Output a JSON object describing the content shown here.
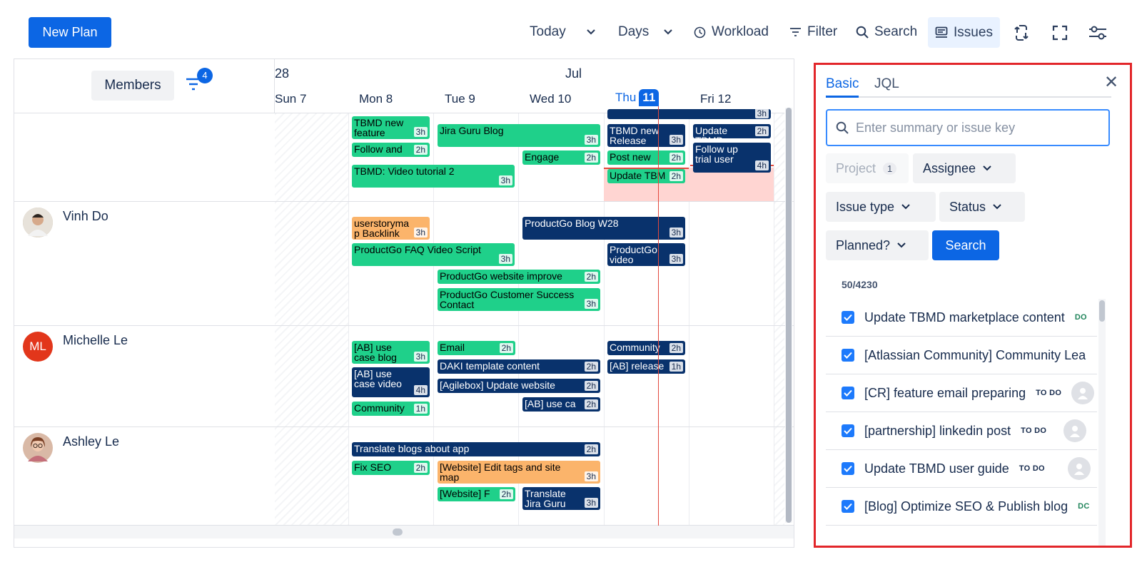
{
  "toolbar": {
    "new_plan_label": "New Plan",
    "today_label": "Today",
    "days_label": "Days",
    "workload_label": "Workload",
    "filter_label": "Filter",
    "search_label": "Search",
    "issues_label": "Issues"
  },
  "members_panel": {
    "members_label": "Members",
    "filter_count": "4"
  },
  "calendar": {
    "months": [
      "28",
      "Jul"
    ],
    "days": [
      "Sun 7",
      "Mon 8",
      "Tue 9",
      "Wed 10",
      "Thu",
      "Fri 12"
    ],
    "today_number": "11"
  },
  "members": [
    {
      "name": "",
      "initials": ""
    },
    {
      "name": "Vinh Do",
      "initials": ""
    },
    {
      "name": "Michelle Le",
      "initials": "ML",
      "color": "#e2361b"
    },
    {
      "name": "Ashley Le",
      "initials": ""
    }
  ],
  "tasks": [
    {
      "title": "TBMD new feature",
      "hours": "3h",
      "color": "green"
    },
    {
      "title": "Jira Guru Blog",
      "hours": "3h",
      "color": "green"
    },
    {
      "title": "TBMD new Release",
      "hours": "3h",
      "color": "navy"
    },
    {
      "title": "Update TBMD",
      "hours": "2h",
      "color": "navy"
    },
    {
      "title": "Follow and",
      "hours": "2h",
      "color": "green"
    },
    {
      "title": "Engage",
      "hours": "2h",
      "color": "green"
    },
    {
      "title": "Post new",
      "hours": "2h",
      "color": "green"
    },
    {
      "title": "Follow up trial user",
      "hours": "4h",
      "color": "navy"
    },
    {
      "title": "TBMD: Video tutorial 2",
      "hours": "3h",
      "color": "green"
    },
    {
      "title": "Update TBM",
      "hours": "2h",
      "color": "green"
    },
    {
      "title": "",
      "hours": "3h",
      "color": "navy"
    },
    {
      "title": "userstorymap Backlink",
      "hours": "3h",
      "color": "orange"
    },
    {
      "title": "ProductGo Blog W28",
      "hours": "3h",
      "color": "navy"
    },
    {
      "title": "ProductGo FAQ Video Script",
      "hours": "3h",
      "color": "green"
    },
    {
      "title": "ProductGo video making",
      "hours": "3h",
      "color": "navy"
    },
    {
      "title": "ProductGo website improve",
      "hours": "2h",
      "color": "green"
    },
    {
      "title": "ProductGo Customer Success Contact",
      "hours": "3h",
      "color": "green"
    },
    {
      "title": "[AB] use case blog",
      "hours": "3h",
      "color": "green"
    },
    {
      "title": "Email",
      "hours": "2h",
      "color": "green"
    },
    {
      "title": "Community",
      "hours": "2h",
      "color": "navy"
    },
    {
      "title": "DAKI template content",
      "hours": "2h",
      "color": "navy"
    },
    {
      "title": "[AB] release",
      "hours": "1h",
      "color": "navy"
    },
    {
      "title": "[AB] use case video",
      "hours": "4h",
      "color": "navy"
    },
    {
      "title": "[Agilebox] Update website",
      "hours": "2h",
      "color": "navy"
    },
    {
      "title": "[AB] use ca",
      "hours": "2h",
      "color": "navy"
    },
    {
      "title": "Community",
      "hours": "1h",
      "color": "green"
    },
    {
      "title": "Translate blogs about app",
      "hours": "2h",
      "color": "navy"
    },
    {
      "title": "Fix SEO",
      "hours": "2h",
      "color": "green"
    },
    {
      "title": "[Website] Edit tags and site map",
      "hours": "3h",
      "color": "orange"
    },
    {
      "title": "[Website] F",
      "hours": "2h",
      "color": "green"
    },
    {
      "title": "Translate Jira Guru Blog",
      "hours": "3h",
      "color": "navy"
    }
  ],
  "issues_panel": {
    "tab_basic": "Basic",
    "tab_jql": "JQL",
    "search_placeholder": "Enter summary or issue key",
    "project_label": "Project",
    "project_count": "1",
    "assignee_label": "Assignee",
    "issue_type_label": "Issue type",
    "status_label": "Status",
    "planned_label": "Planned?",
    "search_button": "Search",
    "result_count": "50/4230",
    "issues": [
      {
        "title": "Update TBMD marketplace content",
        "status": "DO",
        "status_type": "done"
      },
      {
        "title": "[Atlassian Community] Community Lea",
        "status": "",
        "status_type": ""
      },
      {
        "title": "[CR] feature email preparing",
        "status": "TO DO",
        "status_type": "todo"
      },
      {
        "title": "[partnership] linkedin post",
        "status": "TO DO",
        "status_type": "todo"
      },
      {
        "title": "Update TBMD user guide",
        "status": "TO DO",
        "status_type": "todo"
      },
      {
        "title": "[Blog] Optimize SEO & Publish blog",
        "status": "DC",
        "status_type": "done"
      }
    ]
  },
  "colors": {
    "accent": "#0c66e4",
    "green_task": "#1fd08a",
    "navy_task": "#09326c",
    "orange_task": "#fbb46b",
    "highlight_border": "#e2262a",
    "now_line": "#e2483d"
  }
}
